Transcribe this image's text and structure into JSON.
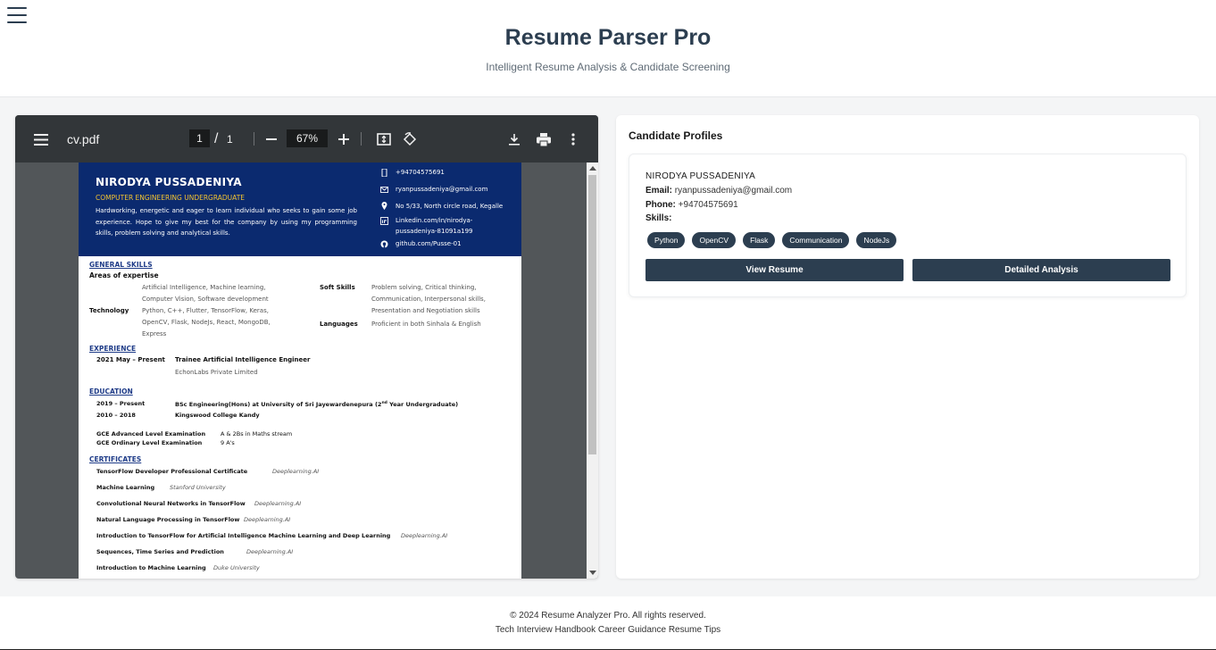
{
  "header": {
    "title": "Resume Parser Pro",
    "subtitle": "Intelligent Resume Analysis & Candidate Screening"
  },
  "pdf_viewer": {
    "file_name": "cv.pdf",
    "current_page": "1",
    "page_separator": "/",
    "total_pages": "1",
    "zoom": "67%",
    "icons": [
      "menu-icon",
      "zoom-out-icon",
      "zoom-in-icon",
      "fit-page-icon",
      "rotate-icon",
      "download-icon",
      "print-icon",
      "more-options-icon"
    ]
  },
  "cv": {
    "name": "NIRODYA PUSSADENIYA",
    "role": "COMPUTER ENGINEERING UNDERGRADUATE",
    "summary": "Hardworking, energetic and eager to learn individual who seeks to gain some job experience. Hope to give my best for the company by using my programming skills, problem solving and analytical skills.",
    "contact": {
      "phone": "+94704575691",
      "email": "ryanpussadeniya@gmail.com",
      "address": "No 5/33, North circle road, Kegalle",
      "linkedin_1": "Linkedin.com/in/nirodya-",
      "linkedin_2": "pussadeniya-81091a199",
      "github": "github.com/Pusse-01"
    },
    "general_skills_heading": "GENERAL SKILLS",
    "areas_heading": "Areas of expertise",
    "areas_1": "Artificial Intelligence, Machine learning,",
    "areas_2": "Computer Vision, Software development",
    "technology_label": "Technology",
    "technology_1": "Python, C++, Flutter, TensorFlow, Keras,",
    "technology_2": "OpenCV, Flask, NodeJs, React, MongoDB,",
    "technology_3": "Express",
    "soft_skills_label": "Soft Skills",
    "soft_skills_1": "Problem solving, Critical thinking,",
    "soft_skills_2": "Communication, Interpersonal skills,",
    "soft_skills_3": "Presentation and Negotiation skills",
    "languages_label": "Languages",
    "languages": "Proficient in both Sinhala & English",
    "experience_heading": "EXPERIENCE",
    "exp_period": "2021 May – Present",
    "exp_title": "Trainee Artificial Intelligence Engineer",
    "exp_company": "EchonLabs Private Limited",
    "education_heading": "EDUCATION",
    "edu_1_period": "2019 – Present",
    "edu_1_text": "BSc Engineering(Hons) at University of Sri Jayewardenepura",
    "edu_1_year": "(2",
    "edu_1_sup": "nd",
    "edu_1_tail": " Year Undergraduate)",
    "edu_2_period": "2010 – 2018",
    "edu_2_text": "Kingswood College Kandy",
    "gce_al_label": "GCE Advanced Level Examination",
    "gce_al_value": "A & 2Bs in Maths stream",
    "gce_ol_label": "GCE Ordinary Level Examination",
    "gce_ol_value": "9 A's",
    "certificates_heading": "CERTIFICATES",
    "certificates": [
      {
        "title": "TensorFlow Developer Professional Certificate",
        "issuer": "Deeplearning.AI"
      },
      {
        "title": "Machine Learning",
        "issuer": "Stanford University"
      },
      {
        "title": "Convolutional Neural Networks in TensorFlow",
        "issuer": "Deeplearning.AI"
      },
      {
        "title": "Natural Language Processing in TensorFlow",
        "issuer": "Deeplearning.AI"
      },
      {
        "title": "Introduction to TensorFlow for Artificial Intelligence Machine Learning and Deep Learning",
        "issuer": "Deeplearning.AI"
      },
      {
        "title": "Sequences, Time Series and Prediction",
        "issuer": "Deeplearning.AI"
      },
      {
        "title": "Introduction to Machine Learning",
        "issuer": "Duke University"
      }
    ]
  },
  "candidates": {
    "title": "Candidate Profiles",
    "profile": {
      "name": "NIRODYA PUSSADENIYA",
      "email_label": "Email:",
      "email": "ryanpussadeniya@gmail.com",
      "phone_label": "Phone:",
      "phone": "+94704575691",
      "skills_label": "Skills:",
      "skills": [
        "Python",
        "OpenCV",
        "Flask",
        "Communication",
        "NodeJs"
      ],
      "view_button": "View Resume",
      "analysis_button": "Detailed Analysis"
    }
  },
  "footer": {
    "copyright": "© 2024 Resume Analyzer Pro. All rights reserved.",
    "links": [
      "Tech Interview Handbook",
      "Career Guidance",
      "Resume Tips"
    ]
  }
}
